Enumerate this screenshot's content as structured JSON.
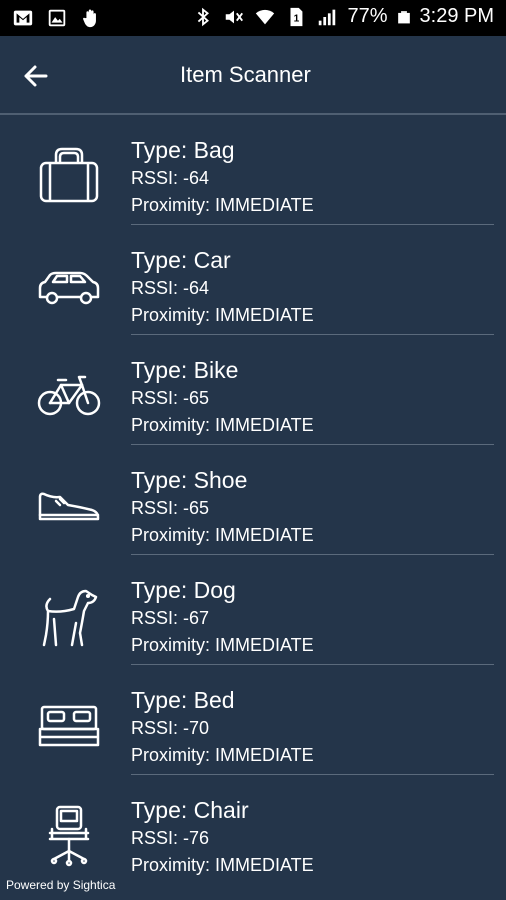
{
  "status_bar": {
    "battery": "77%",
    "time": "3:29 PM",
    "sim": "1",
    "left_icons": [
      "gmail-icon",
      "photo-icon",
      "hand-icon"
    ],
    "right_icons": [
      "bluetooth-icon",
      "mute-icon",
      "wifi-icon",
      "sim-icon",
      "signal-icon",
      "battery-icon"
    ]
  },
  "app_bar": {
    "title": "Item Scanner",
    "back_icon": "arrow-left-icon"
  },
  "items": [
    {
      "type": "Type: Bag",
      "rssi": "RSSI: -64",
      "proximity": "Proximity: IMMEDIATE",
      "icon": "bag-icon"
    },
    {
      "type": "Type: Car",
      "rssi": "RSSI: -64",
      "proximity": "Proximity: IMMEDIATE",
      "icon": "car-icon"
    },
    {
      "type": "Type: Bike",
      "rssi": "RSSI: -65",
      "proximity": "Proximity: IMMEDIATE",
      "icon": "bike-icon"
    },
    {
      "type": "Type: Shoe",
      "rssi": "RSSI: -65",
      "proximity": "Proximity: IMMEDIATE",
      "icon": "shoe-icon"
    },
    {
      "type": "Type: Dog",
      "rssi": "RSSI: -67",
      "proximity": "Proximity: IMMEDIATE",
      "icon": "dog-icon"
    },
    {
      "type": "Type: Bed",
      "rssi": "RSSI: -70",
      "proximity": "Proximity: IMMEDIATE",
      "icon": "bed-icon"
    },
    {
      "type": "Type: Chair",
      "rssi": "RSSI: -76",
      "proximity": "Proximity: IMMEDIATE",
      "icon": "chair-icon"
    }
  ],
  "footer": {
    "powered_by": "Powered by Sightica"
  },
  "colors": {
    "background": "#24354a",
    "status_bar": "#000000",
    "divider": "#5b6a7c",
    "text": "#ffffff"
  }
}
